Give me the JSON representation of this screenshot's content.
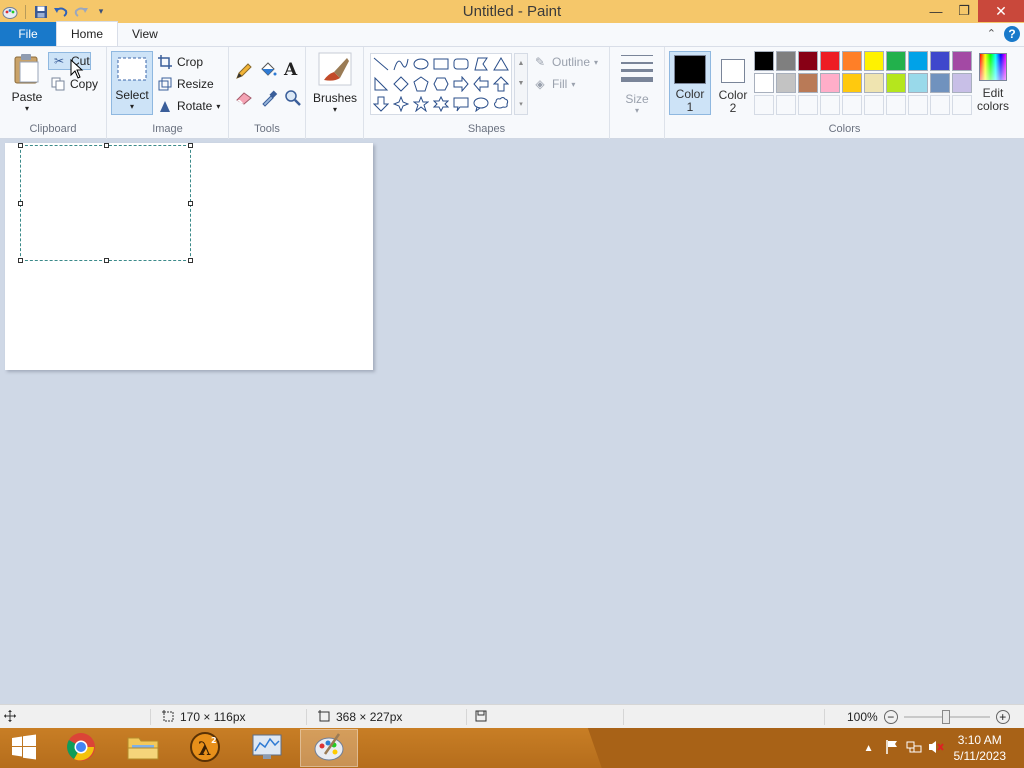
{
  "window": {
    "title": "Untitled - Paint"
  },
  "tabs": {
    "file": "File",
    "home": "Home",
    "view": "View"
  },
  "clipboard": {
    "paste": "Paste",
    "cut": "Cut",
    "copy": "Copy",
    "group_label": "Clipboard"
  },
  "image": {
    "select": "Select",
    "crop": "Crop",
    "resize": "Resize",
    "rotate": "Rotate",
    "group_label": "Image"
  },
  "tools": {
    "group_label": "Tools",
    "items": [
      "pencil-icon",
      "fill-bucket-icon",
      "text-icon",
      "eraser-icon",
      "color-picker-icon",
      "magnifier-icon"
    ]
  },
  "brushes": {
    "label": "Brushes"
  },
  "shapes": {
    "outline": "Outline",
    "fill": "Fill",
    "group_label": "Shapes"
  },
  "size": {
    "label": "Size"
  },
  "colors": {
    "color1_line1": "Color",
    "color1_line2": "1",
    "color2_line1": "Color",
    "color2_line2": "2",
    "edit_line1": "Edit",
    "edit_line2": "colors",
    "group_label": "Colors",
    "color1_value": "#000000",
    "color2_value": "#ffffff",
    "palette_row1": [
      "#000000",
      "#7f7f7f",
      "#880015",
      "#ed1c24",
      "#ff7f27",
      "#fff200",
      "#22b14c",
      "#00a2e8",
      "#3f48cc",
      "#a349a4"
    ],
    "palette_row2": [
      "#ffffff",
      "#c3c3c3",
      "#b97a57",
      "#ffaec9",
      "#ffc90e",
      "#efe4b0",
      "#b5e61d",
      "#99d9ea",
      "#7092be",
      "#c8bfe7"
    ]
  },
  "statusbar": {
    "selection_size": "170 × 116px",
    "canvas_size": "368 × 227px",
    "zoom": "100%"
  },
  "taskbar": {
    "time": "3:10 AM",
    "date": "5/11/2023",
    "hl_badge": "2"
  }
}
